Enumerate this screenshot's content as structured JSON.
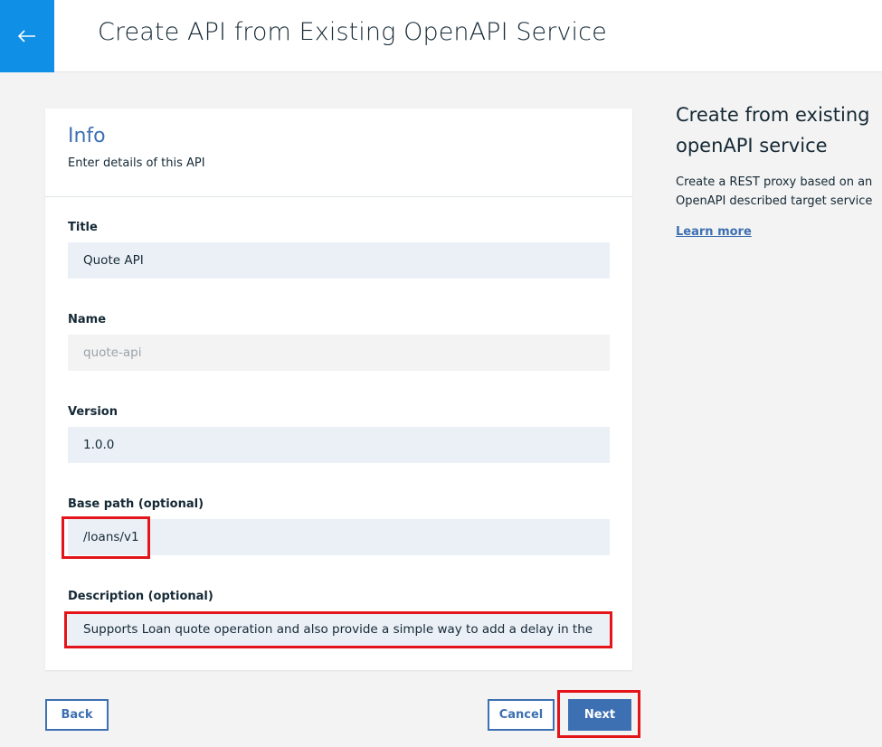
{
  "header": {
    "title": "Create API from Existing OpenAPI Service",
    "back_icon": "arrow-left-icon"
  },
  "card": {
    "title": "Info",
    "subtitle": "Enter details of this API",
    "fields": {
      "title": {
        "label": "Title",
        "value": "Quote API"
      },
      "name": {
        "label": "Name",
        "value": "quote-api"
      },
      "version": {
        "label": "Version",
        "value": "1.0.0"
      },
      "base_path": {
        "label": "Base path (optional)",
        "value": "/loans/v1"
      },
      "description": {
        "label": "Description (optional)",
        "value": "Supports Loan quote operation and also provide a simple way to add a delay in the back end"
      }
    }
  },
  "sidebar": {
    "title": "Create from existing openAPI service",
    "description": "Create a REST proxy based on an OpenAPI described target service",
    "link": "Learn more"
  },
  "buttons": {
    "back": "Back",
    "cancel": "Cancel",
    "next": "Next"
  },
  "colors": {
    "accent": "#0f8fe6",
    "primary": "#3d70b2",
    "highlight": "#e3151a"
  }
}
